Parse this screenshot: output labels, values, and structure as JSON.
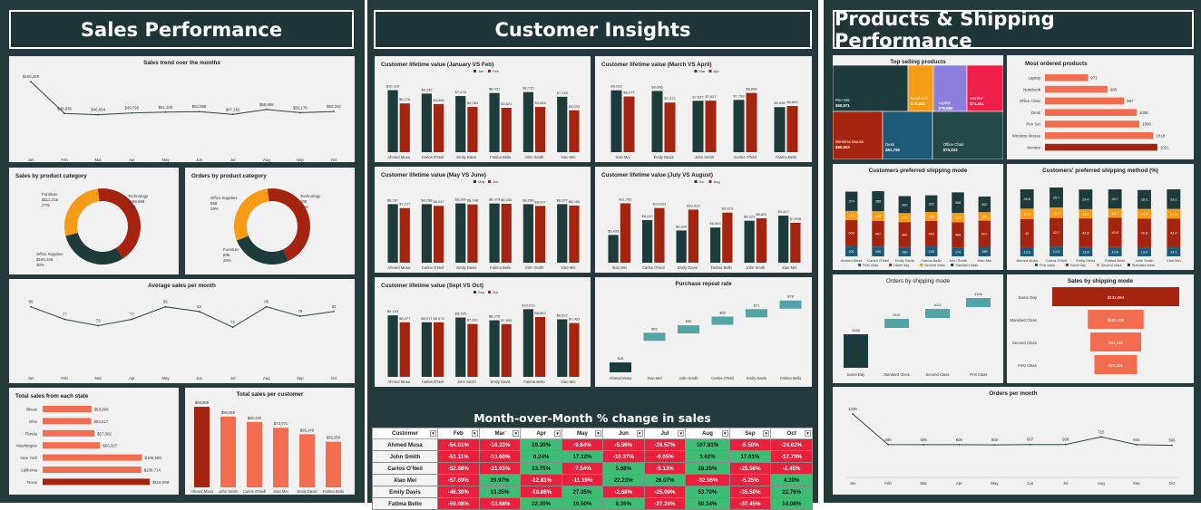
{
  "headers": {
    "sales": "Sales Performance",
    "customer": "Customer Insights",
    "products": "Products & Shipping Performance"
  },
  "colors": {
    "dark": "#1e3b3b",
    "red": "#a52410",
    "orange": "#f26d4f",
    "amber": "#f59b16",
    "teal": "#52a4a6",
    "yellow": "#f5b91a"
  },
  "chart_data": [
    {
      "id": "trend",
      "type": "line",
      "title": "Sales trend over the months",
      "categories": [
        "Jan",
        "Feb",
        "Mar",
        "Apr",
        "May",
        "Jun",
        "Jul",
        "Aug",
        "Sep",
        "Oct"
      ],
      "values": [
        105229,
        48836,
        46654,
        49792,
        51200,
        52088,
        47182,
        55858,
        50170,
        52242
      ],
      "labels": [
        "$105,229",
        "$48,836",
        "$46,654",
        "$49,792",
        "$51,200",
        "$52,088",
        "$47,182",
        "$55,858",
        "$50,170",
        "$52,242"
      ],
      "ylim": [
        30000,
        115000
      ]
    },
    {
      "id": "cat",
      "type": "pie",
      "title": "Sales by product category",
      "segments": [
        {
          "name": "Technology",
          "value": "$208,988",
          "pct": "43%",
          "color": "#a52410"
        },
        {
          "name": "Office Supplies",
          "value": "$185,248",
          "pct": "30%",
          "color": "#1e3b3b"
        },
        {
          "name": "Furniture",
          "value": "$113,315",
          "pct": "27%",
          "color": "#f59b16"
        }
      ],
      "values": [
        43,
        30,
        27
      ]
    },
    {
      "id": "ord",
      "type": "pie",
      "title": "Orders by product category",
      "segments": [
        {
          "name": "Technology",
          "value": "308",
          "pct": "45%",
          "color": "#a52410"
        },
        {
          "name": "Furniture",
          "value": "885",
          "pct": "26%",
          "color": "#1e3b3b"
        },
        {
          "name": "Office Supplies",
          "value": "856",
          "pct": "29%",
          "color": "#f59b16"
        }
      ],
      "values": [
        45,
        26,
        29
      ]
    },
    {
      "id": "avg",
      "type": "line",
      "title": "Average sales per month",
      "categories": [
        "Jan",
        "Feb",
        "Mar",
        "Apr",
        "May",
        "Jun",
        "Jul",
        "Aug",
        "Sep",
        "Oct"
      ],
      "values": [
        85,
        77,
        73,
        77,
        85,
        82,
        72,
        85,
        79,
        82
      ],
      "ylim": [
        60,
        90
      ]
    },
    {
      "id": "state",
      "type": "bar",
      "title": "Total sales from each state",
      "categories": [
        "Illinois",
        "Ohio",
        "Florida",
        "Washington",
        "New York",
        "California",
        "Texas"
      ],
      "values": [
        53865,
        53617,
        57082,
        63327,
        109500,
        108714,
        118099
      ],
      "labels": [
        "$53,865",
        "$53,617",
        "$57,082",
        "$63,327",
        "$109,500",
        "$108,714",
        "$118,099"
      ]
    },
    {
      "id": "cust",
      "type": "bar",
      "title": "Total sales per customer",
      "categories": [
        "Ahmed Musa",
        "John Smith",
        "Carlos O'Neill",
        "Xiao Mei",
        "Emily Davis",
        "Fatima Bello"
      ],
      "values": [
        98808,
        86850,
        80230,
        73071,
        65149,
        55950
      ],
      "labels": [
        "$98,808",
        "$86,850",
        "$80,230",
        "$73,071",
        "$65,149",
        "$55,950"
      ]
    },
    {
      "id": "clv1",
      "type": "bar",
      "title": "Customer lifetime value (January VS Feb)",
      "legend": [
        "Jan",
        "Feb"
      ],
      "categories": [
        "Ahmed Musa",
        "Carlos O'Neil",
        "Emily Davis",
        "Fatima Bello",
        "John Smith",
        "Xiao Mei"
      ],
      "series": [
        {
          "name": "Jan",
          "values": [
            19318,
            18242,
            17478,
            18431,
            18715,
            17245
          ]
        },
        {
          "name": "Feb",
          "values": [
            15176,
            14986,
            14081,
            13821,
            14083,
            13033
          ]
        }
      ],
      "labels": [
        [
          "$19,318",
          "$8,242",
          "$7,478",
          "$8,431",
          "$8,715",
          "$7,245"
        ],
        [
          "$5,176",
          "$4,986",
          "$4,081",
          "$3,821",
          "$4,083",
          "$3,033"
        ]
      ],
      "ylim": [
        0,
        22000
      ]
    },
    {
      "id": "clv2",
      "type": "bar",
      "title": "Customer lifetime value (March VS April)",
      "legend": [
        "Mar",
        "Apr"
      ],
      "categories": [
        "Xiao Mei",
        "Emily Davis",
        "John Smith",
        "Carlos O'Neil",
        "Fatima Bello"
      ],
      "series": [
        {
          "name": "Mar",
          "values": [
            9193,
            9096,
            7637,
            7768,
            6698
          ]
        },
        {
          "name": "Apr",
          "values": [
            8277,
            7372,
            7657,
            8806,
            6863
          ]
        }
      ],
      "labels": [
        [
          "$9,193",
          "$9,096",
          "$7,637",
          "$7,768",
          "$6,698"
        ],
        [
          "$8,277",
          "$7,372",
          "$7,657",
          "$8,806",
          "$6,863"
        ]
      ],
      "ylim": [
        0,
        10500
      ]
    },
    {
      "id": "clv3",
      "type": "bar",
      "title": "Customer lifetime value (May VS June)",
      "legend": [
        "May",
        "Jun"
      ],
      "categories": [
        "Ahmed Musa",
        "Carlos O'Neil",
        "Emily Davis",
        "Fatima Bello",
        "John Smith",
        "Xiao Mei"
      ],
      "series": [
        {
          "name": "May",
          "values": [
            8287,
            8288,
            8389,
            8378,
            8280,
            8287
          ]
        },
        {
          "name": "Jun",
          "values": [
            7727,
            8047,
            8248,
            8336,
            8037,
            8085
          ]
        }
      ],
      "labels": [
        [
          "$8,287",
          "$8,288",
          "$8,389",
          "$8,378",
          "$8,280",
          "$8,287"
        ],
        [
          "$7,727",
          "$8,047",
          "$8,248",
          "$8,336",
          "$8,037",
          "$8,085"
        ]
      ],
      "ylim": [
        0,
        10000
      ]
    },
    {
      "id": "clv4",
      "type": "bar",
      "title": "Customer lifetime value (July VS August)",
      "legend": [
        "Jul",
        "Aug"
      ],
      "categories": [
        "Xiao Mei",
        "Carlos O'Neil",
        "Emily Davis",
        "Fatima Bello",
        "John Smith",
        "Xiao Mei"
      ],
      "series": [
        {
          "name": "Jul",
          "values": [
            5493,
            8442,
            6390,
            6962,
            8323,
            9327
          ]
        },
        {
          "name": "Aug",
          "values": [
            11762,
            10833,
            10519,
            9923,
            8804,
            7898
          ]
        }
      ],
      "labels": [
        [
          "$5,493",
          "$8,442",
          "$6,390",
          "$6,962",
          "$8,323",
          "$9,327"
        ],
        [
          "$11,762",
          "$10,833",
          "$10,519",
          "$9,923",
          "$8,804",
          "$7,898"
        ]
      ],
      "ylim": [
        0,
        14000
      ]
    },
    {
      "id": "clv5",
      "type": "bar",
      "title": "Customer lifetime value (Sept VS Oct)",
      "legend": [
        "Sep",
        "Oct"
      ],
      "categories": [
        "Ahmed Musa",
        "Carlos O'Neil",
        "John Smith",
        "Emily Davis",
        "Fatima Bello",
        "Xiao Mei"
      ],
      "series": [
        {
          "name": "Sep",
          "values": [
            9103,
            8077,
            8785,
            8376,
            10019,
            8522
          ]
        },
        {
          "name": "Oct",
          "values": [
            8077,
            8073,
            7831,
            7805,
            8853,
            7963
          ]
        }
      ],
      "labels": [
        [
          "$9,103",
          "$8,077",
          "$8,785",
          "$8,376",
          "$10,019",
          "$8,522"
        ],
        [
          "$8,077",
          "$8,073",
          "$7,831",
          "$7,805",
          "$8,853",
          "$7,963"
        ]
      ],
      "ylim": [
        0,
        11000
      ]
    },
    {
      "id": "repeat",
      "type": "bar",
      "title": "Purchase repeat rate",
      "categories": [
        "Ahmed Musa",
        "Xiao Mei",
        "John Smith",
        "Carlos O'Neil",
        "Emily Davis",
        "Fatima Bello"
      ],
      "values": [
        28,
        52,
        58,
        65,
        71,
        78
      ],
      "labels": [
        "$28",
        "$52",
        "$58",
        "$65",
        "$71",
        "$78"
      ]
    },
    {
      "id": "treemap",
      "type": "heatmap",
      "title": "Top selling products",
      "items": [
        {
          "name": "Pen Set",
          "value": "$50,971",
          "color": "#1e3b3b"
        },
        {
          "name": "Notebook",
          "value": "$76,008",
          "color": "#f59b16"
        },
        {
          "name": "Laptop",
          "value": "$78,880",
          "color": "#8b7fdd"
        },
        {
          "name": "Monitor",
          "value": "$74,461",
          "color": "#f01f4a"
        },
        {
          "name": "Wireless Mouse",
          "value": "$80,902",
          "color": "#a52410"
        },
        {
          "name": "Desk",
          "value": "$81,769",
          "color": "#1d5a78"
        },
        {
          "name": "Office Chair",
          "value": "$75,033",
          "color": "#234a46"
        }
      ]
    },
    {
      "id": "most",
      "type": "bar",
      "title": "Most ordered products",
      "categories": [
        "Laptop",
        "Notebook",
        "Office Chair",
        "Desk",
        "Pen Set",
        "Wireless Mouse",
        "Monitor"
      ],
      "values": [
        971,
        985,
        997,
        1006,
        1008,
        1018,
        1021
      ]
    },
    {
      "id": "shipmode",
      "type": "bar",
      "title": "Customers preferred shipping mode",
      "legend": [
        "First class",
        "Same day",
        "Second class",
        "Standard class"
      ],
      "categories": [
        "Ahmed Musa",
        "Carlos O'Neil",
        "Emily Davis",
        "Fatima Bello",
        "John Smith",
        "Xiao Mei"
      ],
      "series": [
        {
          "name": "First class",
          "values": [
            201,
            190,
            180,
            193,
            174,
            185
          ]
        },
        {
          "name": "Same day",
          "values": [
            504,
            497,
            484,
            493,
            488,
            507
          ]
        },
        {
          "name": "Second class",
          "values": [
            176,
            189,
            175,
            176,
            181,
            166
          ]
        },
        {
          "name": "Standard class",
          "values": [
            374,
            388,
            330,
            322,
            398,
            302
          ]
        }
      ]
    },
    {
      "id": "shippct",
      "type": "bar",
      "title": "Customers' preferred shipping method (%)",
      "legend": [
        "First class",
        "Same day",
        "Second class",
        "Standard class"
      ],
      "categories": [
        "Ahmed Musa",
        "Carlos O'Neil",
        "Emily Davis",
        "Fatima Bello",
        "John Smith",
        "Xiao Mei"
      ],
      "series": [
        {
          "name": "First class",
          "values": [
            13.6,
            14.6,
            13.8,
            13.8,
            13.6,
            14.1
          ]
        },
        {
          "name": "Same day",
          "values": [
            42,
            42.7,
            42.8,
            43.8,
            42.8,
            42.4
          ]
        },
        {
          "name": "Second class",
          "values": [
            15.6,
            15.7,
            13.8,
            13.7,
            14.4,
            14.3
          ]
        },
        {
          "name": "Standard class",
          "values": [
            28.8,
            29.7,
            29.4,
            28.7,
            28.2,
            29.2
          ]
        }
      ]
    },
    {
      "id": "ordship",
      "type": "bar",
      "title": "Orders by shipping mode",
      "categories": [
        "Same Day",
        "Standard Class",
        "Second Class",
        "First Class"
      ],
      "values": [
        2688,
        2841,
        1021,
        1188
      ],
      "labels": [
        "2688",
        "2841",
        "1021",
        "1188"
      ]
    },
    {
      "id": "salesship",
      "type": "bar",
      "title": "Sales by shipping mode",
      "categories": [
        "Same Day",
        "Standard Class",
        "Second Class",
        "First Class"
      ],
      "values": [
        232894,
        102408,
        93226,
        78231
      ],
      "labels": [
        "$232,894",
        "$102,408",
        "$93,226",
        "$78,231"
      ]
    },
    {
      "id": "ordmonth",
      "type": "line",
      "title": "Orders per month",
      "categories": [
        "Jan",
        "Feb",
        "Mar",
        "Apr",
        "May",
        "Jun",
        "Jul",
        "Aug",
        "Sep",
        "Oct"
      ],
      "values": [
        1036,
        606,
        605,
        605,
        602,
        607,
        608,
        715,
        605,
        596
      ],
      "ylim": [
        400,
        1100
      ]
    }
  ],
  "mom": {
    "title": "Month-over-Month % change in sales",
    "columns": [
      "Customer",
      "Feb",
      "Mar",
      "Apr",
      "May",
      "Jun",
      "Jul",
      "Aug",
      "Sep",
      "Oct"
    ],
    "rows": [
      [
        "Ahmed Musa",
        "-54.01%",
        "-16.23%",
        "19.30%",
        "-9.84%",
        "-5.56%",
        "-26.57%",
        "107.81%",
        "-5.50%",
        "-24.62%"
      ],
      [
        "John Smith",
        "-51.11%",
        "-13.60%",
        "0.24%",
        "17.12%",
        "-10.37%",
        "-0.05%",
        "3.62%",
        "17.01%",
        "-17.79%"
      ],
      [
        "Carlos O'Neil",
        "-52.88%",
        "-21.03%",
        "33.75%",
        "-7.54%",
        "5.98%",
        "-5.13%",
        "28.35%",
        "-25.50%",
        "-2.45%"
      ],
      [
        "Xiao Mei",
        "-57.69%",
        "29.97%",
        "-12.81%",
        "-11.19%",
        "22.23%",
        "26.07%",
        "-32.06%",
        "-5.25%",
        "4.39%"
      ],
      [
        "Emily Davis",
        "-46.30%",
        "13.35%",
        "-18.86%",
        "27.35%",
        "-2.68%",
        "-25.09%",
        "53.70%",
        "-35.50%",
        "22.76%"
      ],
      [
        "Fatima Bello",
        "-59.08%",
        "-13.68%",
        "22.20%",
        "19.50%",
        "8.35%",
        "-27.24%",
        "50.34%",
        "-37.45%",
        "14.08%"
      ]
    ]
  }
}
